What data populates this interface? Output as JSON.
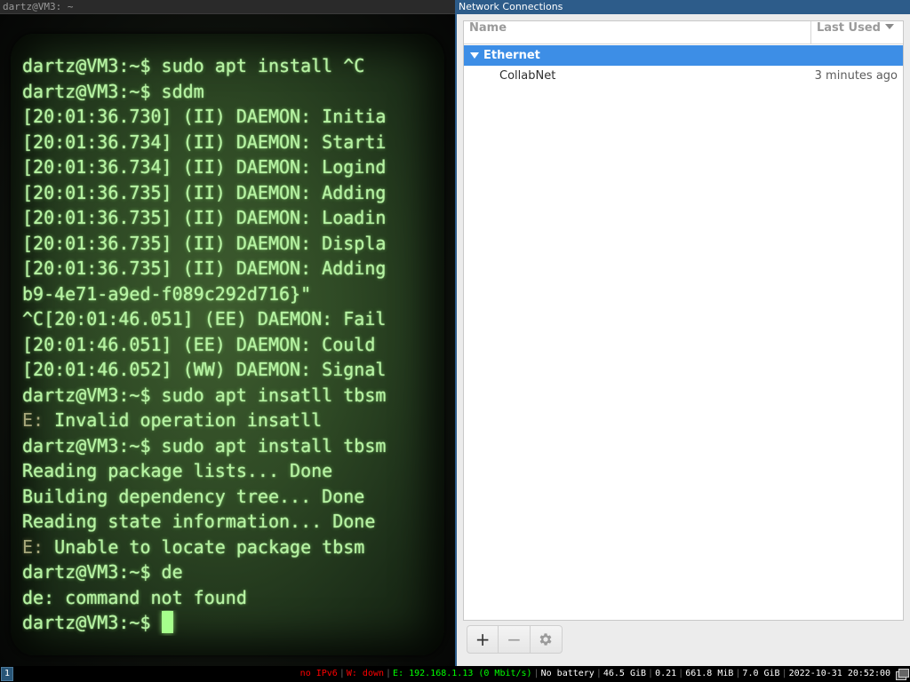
{
  "terminal": {
    "title": "dartz@VM3: ~",
    "lines": [
      {
        "text": "dartz@VM3:~$ sudo apt install ^C"
      },
      {
        "text": "dartz@VM3:~$ sddm"
      },
      {
        "text": "[20:01:36.730] (II) DAEMON: Initia"
      },
      {
        "text": "[20:01:36.734] (II) DAEMON: Starti"
      },
      {
        "text": "[20:01:36.734] (II) DAEMON: Logind"
      },
      {
        "text": "[20:01:36.735] (II) DAEMON: Adding"
      },
      {
        "text": "[20:01:36.735] (II) DAEMON: Loadin"
      },
      {
        "text": "[20:01:36.735] (II) DAEMON: Displa"
      },
      {
        "text": "[20:01:36.735] (II) DAEMON: Adding"
      },
      {
        "text": "b9-4e71-a9ed-f089c292d716}\""
      },
      {
        "text": "^C[20:01:46.051] (EE) DAEMON: Fail"
      },
      {
        "text": "[20:01:46.051] (EE) DAEMON: Could"
      },
      {
        "text": "[20:01:46.052] (WW) DAEMON: Signal"
      },
      {
        "text": "dartz@VM3:~$ sudo apt insatll tbsm"
      },
      {
        "prefix": "E:",
        "text": " Invalid operation insatll"
      },
      {
        "text": "dartz@VM3:~$ sudo apt install tbsm"
      },
      {
        "text": "Reading package lists... Done"
      },
      {
        "text": "Building dependency tree... Done"
      },
      {
        "text": "Reading state information... Done"
      },
      {
        "prefix": "E:",
        "text": " Unable to locate package tbsm"
      },
      {
        "text": "dartz@VM3:~$ de"
      },
      {
        "text": "de: command not found"
      },
      {
        "text": "dartz@VM3:~$ ",
        "cursor": true
      }
    ],
    "colors": {
      "phosphor": "#b6f3a2",
      "error_prefix": "#a7a77a"
    }
  },
  "network": {
    "title": "Network Connections",
    "columns": {
      "name": "Name",
      "last_used": "Last Used"
    },
    "group": {
      "label": "Ethernet",
      "expanded": true
    },
    "connections": [
      {
        "name": "CollabNet",
        "last_used": "3 minutes ago"
      }
    ],
    "toolbar": {
      "add": "+",
      "remove": "−",
      "settings_icon": "gear-icon"
    },
    "colors": {
      "selection": "#3d8ee6",
      "titlebar": "#2d5c8a"
    }
  },
  "statusbar": {
    "workspace": "1",
    "ipv6": "no IPv6",
    "wireless": "W: down",
    "ethernet": "E: 192.168.1.13 (0 Mbit/s)",
    "battery": "No battery",
    "disk": "46.5 GiB",
    "load": "0.21",
    "memory": "661.8 MiB",
    "memory_total": "7.0 GiB",
    "datetime": "2022-10-31 20:52:00"
  }
}
